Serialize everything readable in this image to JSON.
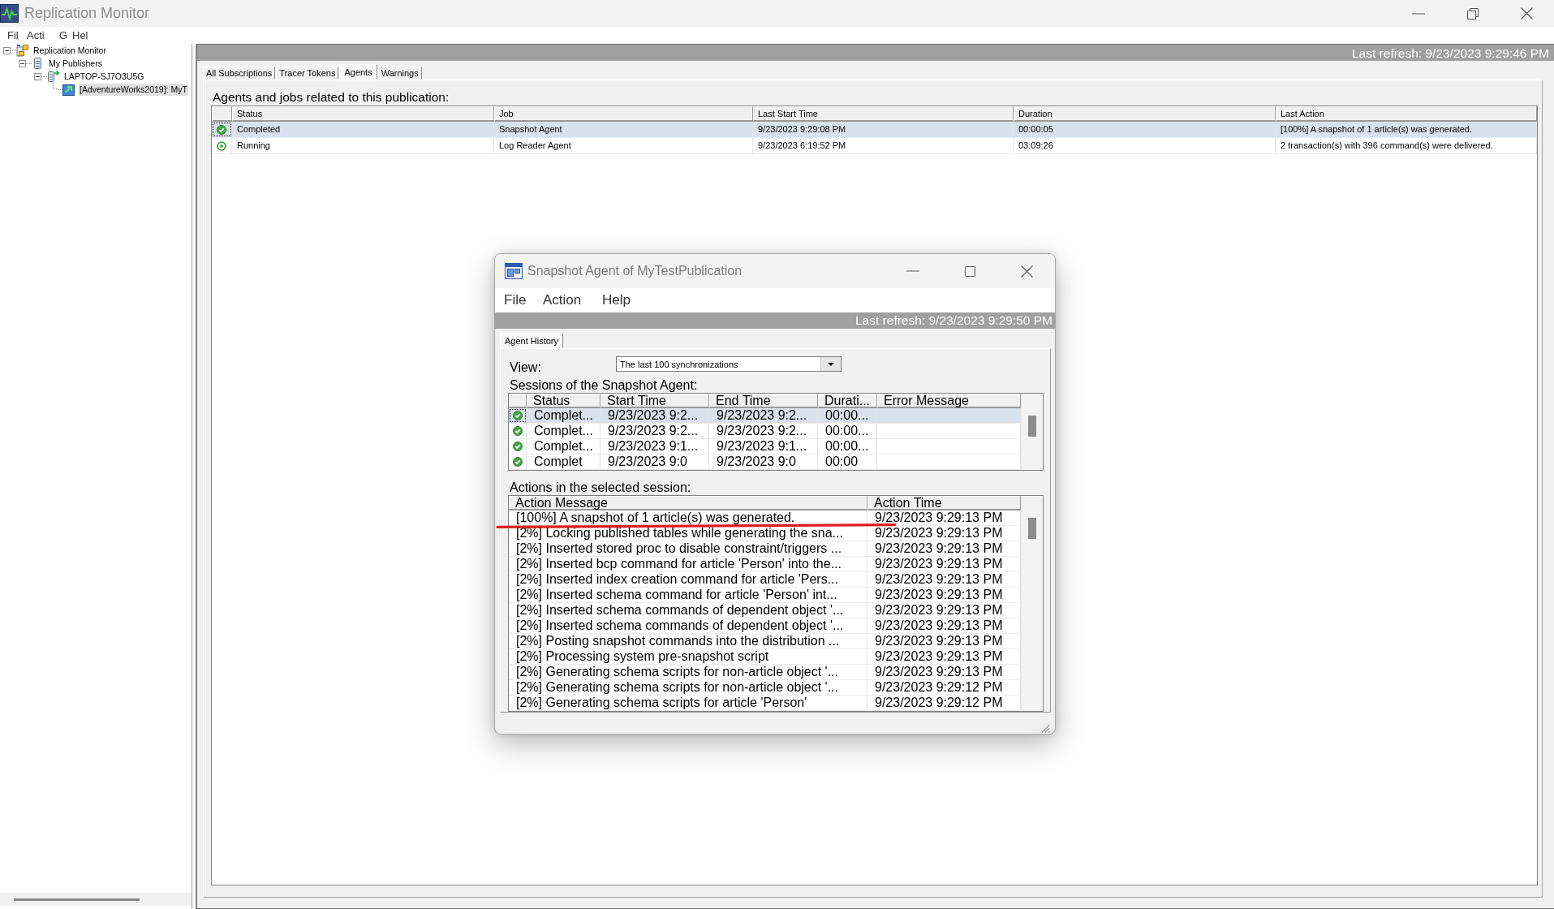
{
  "window": {
    "title": "Replication Monitor"
  },
  "menu": [
    "Fil",
    "Acti",
    "G",
    "Hel"
  ],
  "tree": [
    {
      "kind": "monitor",
      "label": "Replication Monitor",
      "expanded": true,
      "selected": false,
      "children": [
        {
          "kind": "publishers",
          "label": "My Publishers",
          "expanded": true,
          "selected": false,
          "children": [
            {
              "kind": "publisher",
              "label": "LAPTOP-SJ7O3U5G",
              "expanded": true,
              "selected": false,
              "children": [
                {
                  "kind": "publication",
                  "label": "[AdventureWorks2019]: MyT",
                  "selected": true
                }
              ]
            }
          ]
        }
      ]
    }
  ],
  "refresh": "Last refresh: 9/23/2023 9:29:46 PM",
  "tabs": [
    {
      "label": "All Subscriptions",
      "selected": false
    },
    {
      "label": "Tracer Tokens",
      "selected": false
    },
    {
      "label": "Agents",
      "selected": true
    },
    {
      "label": "Warnings",
      "selected": false
    }
  ],
  "agents": {
    "caption": "Agents and jobs related to this publication:",
    "columns": [
      "Status",
      "Job",
      "Last Start Time",
      "Duration",
      "Last Action"
    ],
    "rows": [
      {
        "kind": "completed",
        "selected": true,
        "cells": [
          "Completed",
          "Snapshot Agent",
          "9/23/2023 9:29:08 PM",
          "00:00:05",
          "[100%] A snapshot of 1 article(s) was generated."
        ]
      },
      {
        "kind": "running",
        "selected": false,
        "cells": [
          "Running",
          "Log Reader Agent",
          "9/23/2023 6:19:52 PM",
          "03:09:26",
          "2 transaction(s) with 396 command(s) were delivered."
        ]
      }
    ]
  },
  "dialog": {
    "title": "Snapshot Agent of MyTestPublication",
    "menu": [
      "File",
      "Action",
      "Help"
    ],
    "refresh": "Last refresh: 9/23/2023 9:29:50 PM",
    "tabs": [
      {
        "label": "Agent History",
        "selected": true
      }
    ],
    "view": {
      "label": "View:",
      "value": "The last 100 synchronizations"
    },
    "sessions": {
      "caption": "Sessions of the Snapshot Agent:",
      "columns": [
        "Status",
        "Start Time",
        "End Time",
        "Durati...",
        "Error Message"
      ],
      "rows": [
        {
          "kind": "completed",
          "selected": true,
          "cells": [
            "Complet...",
            "9/23/2023 9:2...",
            "9/23/2023 9:2...",
            "00:00..."
          ]
        },
        {
          "kind": "completed",
          "selected": false,
          "cells": [
            "Complet...",
            "9/23/2023 9:2...",
            "9/23/2023 9:2...",
            "00:00..."
          ]
        },
        {
          "kind": "completed",
          "selected": false,
          "cells": [
            "Complet...",
            "9/23/2023 9:1...",
            "9/23/2023 9:1...",
            "00:00..."
          ]
        },
        {
          "kind": "completed",
          "selected": false,
          "cells": [
            "Complet",
            "9/23/2023 9:0",
            "9/23/2023 9:0",
            "00:00"
          ]
        }
      ]
    },
    "actions": {
      "caption": "Actions in the selected session:",
      "columns": [
        "Action Message",
        "Action Time"
      ],
      "rows": [
        [
          "[100%] A snapshot of 1 article(s) was generated.",
          "9/23/2023 9:29:13 PM"
        ],
        [
          "[2%] Locking published tables while generating the sna...",
          "9/23/2023 9:29:13 PM"
        ],
        [
          "[2%] Inserted stored proc to disable constraint/triggers ...",
          "9/23/2023 9:29:13 PM"
        ],
        [
          "[2%] Inserted bcp command for article 'Person' into the...",
          "9/23/2023 9:29:13 PM"
        ],
        [
          "[2%] Inserted index creation command for article 'Pers...",
          "9/23/2023 9:29:13 PM"
        ],
        [
          "[2%] Inserted schema command for article 'Person' int...",
          "9/23/2023 9:29:13 PM"
        ],
        [
          "[2%] Inserted schema commands of dependent object '...",
          "9/23/2023 9:29:13 PM"
        ],
        [
          "[2%] Inserted schema commands of dependent object '...",
          "9/23/2023 9:29:13 PM"
        ],
        [
          "[2%] Posting snapshot commands into the distribution ...",
          "9/23/2023 9:29:13 PM"
        ],
        [
          "[2%] Processing system pre-snapshot script",
          "9/23/2023 9:29:13 PM"
        ],
        [
          "[2%] Generating schema scripts for non-article object '...",
          "9/23/2023 9:29:13 PM"
        ],
        [
          "[2%] Generating schema scripts for non-article object '...",
          "9/23/2023 9:29:12 PM"
        ],
        [
          "[2%] Generating schema scripts for article 'Person'",
          "9/23/2023 9:29:12 PM"
        ]
      ]
    }
  }
}
